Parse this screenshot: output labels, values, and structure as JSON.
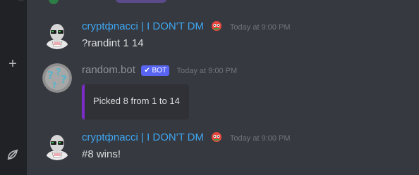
{
  "sidebar": {
    "add_icon": "plus-icon",
    "bottom_icon": "leaf-slash-icon"
  },
  "messages": [
    {
      "username": "cryptфnacci | I DON'T DM",
      "badge_icon": "pepe-emoji-icon",
      "timestamp": "Today at 9:00 PM",
      "text": "?randint 1 14"
    },
    {
      "username": "random.bot",
      "bot_tag": "✔ BOT",
      "timestamp": "Today at 9:00 PM",
      "embed": {
        "text": "Picked 8 from 1 to 14",
        "accent": "#7b2cc9"
      }
    },
    {
      "username": "cryptфnacci | I DON'T DM",
      "badge_icon": "pepe-emoji-icon",
      "timestamp": "Today at 9:00 PM",
      "text": "#8 wins!"
    }
  ],
  "colors": {
    "background": "#36393f",
    "rail": "#202225",
    "username": "#3ea6f2",
    "bot_username": "#8e9297",
    "bot_tag": "#5865f2",
    "timestamp": "#72767d"
  }
}
